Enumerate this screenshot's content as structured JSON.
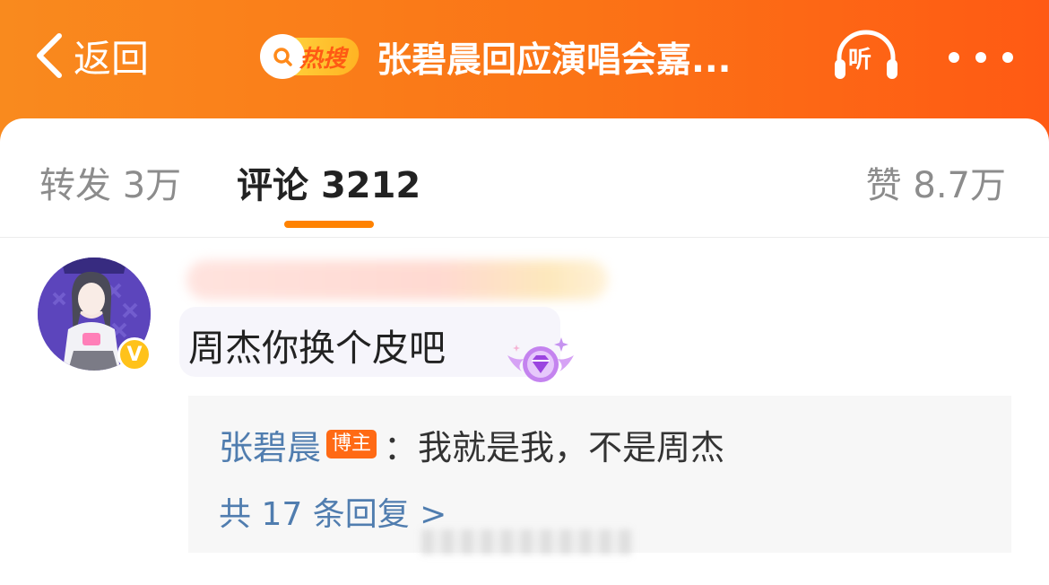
{
  "header": {
    "back_label": "返回",
    "hot_badge_text": "热搜",
    "title": "张碧晨回应演唱会嘉...",
    "listen_label": "听"
  },
  "tabs": {
    "repost_label": "转发",
    "repost_count": "3万",
    "comment_label": "评论",
    "comment_count": "3212",
    "like_label": "赞",
    "like_count": "8.7万"
  },
  "comment": {
    "verified_mark": "V",
    "text": "周杰你换个皮吧"
  },
  "reply": {
    "author": "张碧晨",
    "author_tag": "博主",
    "text": "：我就是我，不是周杰",
    "more_label": "共 17 条回复 >"
  },
  "colors": {
    "header_gradient_start": "#f98a1e",
    "header_gradient_end": "#ff5a14",
    "tab_indicator": "#ff8200",
    "link_blue": "#507daf",
    "verified_gold": "#ffc21a"
  }
}
